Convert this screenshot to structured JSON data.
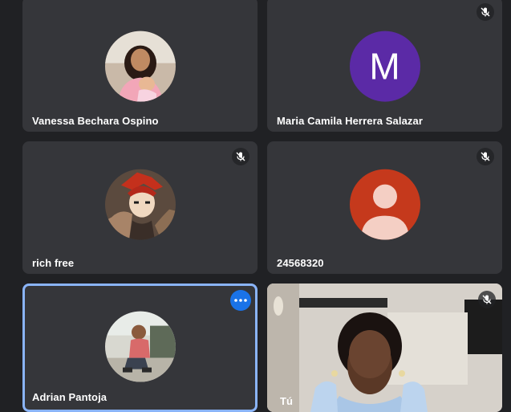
{
  "participants": [
    {
      "name": "Vanessa Bechara Ospino",
      "muted": false,
      "avatar": "photo-woman-with-baby"
    },
    {
      "name": "Maria Camila Herrera Salazar",
      "muted": true,
      "avatar": "letter",
      "initial": "M",
      "color": "#5b2aa6"
    },
    {
      "name": "rich free",
      "muted": true,
      "avatar": "photo-anime-character"
    },
    {
      "name": "24568320",
      "muted": true,
      "avatar": "default-person",
      "color": "#c5391c"
    },
    {
      "name": "Adrian Pantoja",
      "muted": false,
      "avatar": "photo-man-crouching",
      "active": true,
      "more_icon": "more-horizontal-icon"
    },
    {
      "name": "Tú",
      "muted": true,
      "avatar": "video-feed"
    }
  ],
  "colors": {
    "background": "#202124",
    "tile": "#35363a",
    "active_border": "#8ab4f8",
    "more_button": "#1a73e8"
  }
}
